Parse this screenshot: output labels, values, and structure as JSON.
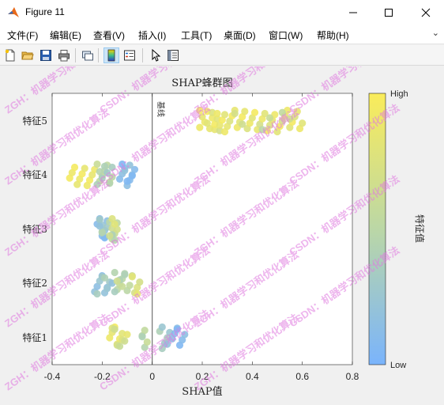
{
  "window": {
    "title": "Figure 11"
  },
  "menubar": {
    "items": [
      {
        "label": "文件(F)"
      },
      {
        "label": "编辑(E)"
      },
      {
        "label": "查看(V)"
      },
      {
        "label": "插入(I)"
      },
      {
        "label": "工具(T)"
      },
      {
        "label": "桌面(D)"
      },
      {
        "label": "窗口(W)"
      },
      {
        "label": "帮助(H)"
      }
    ],
    "more_glyph": "⌄"
  },
  "toolbar": {
    "buttons": [
      {
        "name": "new-figure-button",
        "icon": "new-file-icon"
      },
      {
        "name": "open-file-button",
        "icon": "folder-open-icon"
      },
      {
        "name": "save-button",
        "icon": "save-icon"
      },
      {
        "name": "print-button",
        "icon": "printer-icon"
      },
      {
        "name": "link-plot-button",
        "icon": "link-plot-icon"
      },
      {
        "name": "insert-colorbar-button",
        "icon": "colorbar-icon",
        "active": true
      },
      {
        "name": "insert-legend-button",
        "icon": "legend-icon"
      },
      {
        "name": "edit-plot-button",
        "icon": "pointer-icon"
      },
      {
        "name": "property-inspector-button",
        "icon": "property-inspector-icon"
      }
    ]
  },
  "colors": {
    "low": "#7ab4fc",
    "mid": "#bbd7a6",
    "high": "#faec5a",
    "watermark": "#e07ae0"
  },
  "watermark": {
    "texts": [
      "ZGH：机器学习和优化算法",
      "CSDN：机器学习和优化算法"
    ]
  },
  "chart_data": {
    "type": "scatter",
    "title": "SHAP蜂群图",
    "xlabel": "SHAP值",
    "ylabel": "",
    "xlim": [
      -0.4,
      0.8
    ],
    "xticks": [
      "-0.4",
      "-0.2",
      "0",
      "0.2",
      "0.4",
      "0.6",
      "0.8"
    ],
    "categories": [
      "特征1",
      "特征2",
      "特征3",
      "特征4",
      "特征5"
    ],
    "baseline_label": "基线",
    "baseline_x": 0,
    "colorbar": {
      "label": "特征值",
      "high": "High",
      "low": "Low"
    },
    "series": [
      {
        "feature": "特征5",
        "points": [
          [
            0.19,
            0.95
          ],
          [
            0.19,
            0.9
          ],
          [
            0.21,
            0.9
          ],
          [
            0.2,
            0.85
          ],
          [
            0.22,
            0.95
          ],
          [
            0.23,
            0.85
          ],
          [
            0.22,
            0.8
          ],
          [
            0.24,
            0.9
          ],
          [
            0.24,
            0.75
          ],
          [
            0.25,
            0.85
          ],
          [
            0.25,
            0.95
          ],
          [
            0.26,
            0.8
          ],
          [
            0.26,
            0.9
          ],
          [
            0.27,
            0.7
          ],
          [
            0.27,
            0.85
          ],
          [
            0.28,
            0.95
          ],
          [
            0.29,
            0.8
          ],
          [
            0.29,
            0.9
          ],
          [
            0.3,
            0.85
          ],
          [
            0.31,
            0.75
          ],
          [
            0.32,
            0.95
          ],
          [
            0.33,
            0.85
          ],
          [
            0.34,
            0.9
          ],
          [
            0.35,
            0.8
          ],
          [
            0.36,
            0.95
          ],
          [
            0.37,
            0.85
          ],
          [
            0.38,
            0.75
          ],
          [
            0.39,
            0.9
          ],
          [
            0.4,
            0.8
          ],
          [
            0.41,
            0.95
          ],
          [
            0.42,
            0.85
          ],
          [
            0.43,
            0.7
          ],
          [
            0.44,
            0.9
          ],
          [
            0.45,
            0.8
          ],
          [
            0.46,
            0.95
          ],
          [
            0.47,
            0.75
          ],
          [
            0.48,
            0.85
          ],
          [
            0.49,
            0.9
          ],
          [
            0.5,
            0.8
          ],
          [
            0.51,
            0.95
          ],
          [
            0.52,
            0.7
          ],
          [
            0.53,
            0.85
          ],
          [
            0.54,
            0.9
          ],
          [
            0.55,
            0.8
          ],
          [
            0.56,
            0.95
          ],
          [
            0.57,
            0.75
          ],
          [
            0.58,
            0.85
          ],
          [
            0.59,
            0.9
          ],
          [
            0.6,
            0.8
          ],
          [
            0.47,
            0.6
          ],
          [
            0.52,
            0.55
          ],
          [
            0.44,
            0.5
          ],
          [
            0.36,
            0.65
          ],
          [
            0.55,
            0.65
          ],
          [
            0.33,
            0.7
          ]
        ]
      },
      {
        "feature": "特征4",
        "points": [
          [
            -0.33,
            0.95
          ],
          [
            -0.32,
            0.9
          ],
          [
            -0.31,
            0.95
          ],
          [
            -0.3,
            0.85
          ],
          [
            -0.29,
            0.9
          ],
          [
            -0.28,
            0.95
          ],
          [
            -0.27,
            0.85
          ],
          [
            -0.26,
            0.9
          ],
          [
            -0.25,
            0.95
          ],
          [
            -0.24,
            0.85
          ],
          [
            -0.23,
            0.9
          ],
          [
            -0.22,
            0.6
          ],
          [
            -0.21,
            0.55
          ],
          [
            -0.2,
            0.65
          ],
          [
            -0.19,
            0.5
          ],
          [
            -0.18,
            0.55
          ],
          [
            -0.17,
            0.6
          ],
          [
            -0.16,
            0.5
          ],
          [
            -0.21,
            0.45
          ],
          [
            -0.19,
            0.4
          ],
          [
            -0.17,
            0.45
          ],
          [
            -0.2,
            0.35
          ],
          [
            -0.18,
            0.3
          ],
          [
            -0.16,
            0.35
          ],
          [
            -0.22,
            0.4
          ],
          [
            -0.13,
            0.1
          ],
          [
            -0.12,
            0.15
          ],
          [
            -0.11,
            0.1
          ],
          [
            -0.1,
            0.15
          ],
          [
            -0.09,
            0.1
          ],
          [
            -0.08,
            0.15
          ],
          [
            -0.07,
            0.1
          ],
          [
            -0.12,
            0.05
          ],
          [
            -0.1,
            0.05
          ],
          [
            -0.08,
            0.05
          ],
          [
            -0.11,
            0.2
          ],
          [
            -0.09,
            0.2
          ]
        ]
      },
      {
        "feature": "特征3",
        "points": [
          [
            -0.22,
            0.1
          ],
          [
            -0.21,
            0.15
          ],
          [
            -0.2,
            0.1
          ],
          [
            -0.19,
            0.2
          ],
          [
            -0.2,
            0.25
          ],
          [
            -0.21,
            0.3
          ],
          [
            -0.19,
            0.35
          ],
          [
            -0.2,
            0.4
          ],
          [
            -0.21,
            0.2
          ],
          [
            -0.18,
            0.15
          ],
          [
            -0.19,
            0.05
          ],
          [
            -0.2,
            0.45
          ],
          [
            -0.18,
            0.3
          ],
          [
            -0.17,
            0.5
          ],
          [
            -0.16,
            0.55
          ],
          [
            -0.15,
            0.6
          ],
          [
            -0.16,
            0.65
          ],
          [
            -0.14,
            0.5
          ],
          [
            -0.15,
            0.45
          ],
          [
            -0.16,
            0.4
          ],
          [
            -0.14,
            0.7
          ],
          [
            -0.15,
            0.8
          ],
          [
            -0.16,
            0.75
          ],
          [
            -0.17,
            0.65
          ]
        ]
      },
      {
        "feature": "特征2",
        "points": [
          [
            -0.23,
            0.2
          ],
          [
            -0.22,
            0.15
          ],
          [
            -0.21,
            0.25
          ],
          [
            -0.2,
            0.1
          ],
          [
            -0.19,
            0.2
          ],
          [
            -0.18,
            0.15
          ],
          [
            -0.17,
            0.3
          ],
          [
            -0.2,
            0.3
          ],
          [
            -0.22,
            0.35
          ],
          [
            -0.18,
            0.25
          ],
          [
            -0.16,
            0.2
          ],
          [
            -0.19,
            0.4
          ],
          [
            -0.15,
            0.45
          ],
          [
            -0.14,
            0.5
          ],
          [
            -0.13,
            0.55
          ],
          [
            -0.12,
            0.5
          ],
          [
            -0.11,
            0.45
          ],
          [
            -0.1,
            0.5
          ],
          [
            -0.09,
            0.55
          ],
          [
            -0.13,
            0.4
          ],
          [
            -0.11,
            0.4
          ],
          [
            -0.15,
            0.35
          ],
          [
            -0.12,
            0.6
          ],
          [
            -0.14,
            0.65
          ],
          [
            -0.08,
            0.65
          ],
          [
            -0.07,
            0.7
          ],
          [
            -0.06,
            0.75
          ],
          [
            -0.05,
            0.7
          ],
          [
            -0.08,
            0.8
          ],
          [
            -0.06,
            0.85
          ]
        ]
      },
      {
        "feature": "特征1",
        "points": [
          [
            -0.17,
            0.9
          ],
          [
            -0.16,
            0.85
          ],
          [
            -0.15,
            0.95
          ],
          [
            -0.14,
            0.85
          ],
          [
            -0.13,
            0.9
          ],
          [
            -0.12,
            0.8
          ],
          [
            -0.16,
            0.75
          ],
          [
            -0.14,
            0.7
          ],
          [
            -0.12,
            0.75
          ],
          [
            -0.1,
            0.85
          ],
          [
            -0.15,
            0.65
          ],
          [
            -0.13,
            0.6
          ],
          [
            -0.11,
            0.65
          ],
          [
            -0.04,
            0.5
          ],
          [
            -0.03,
            0.55
          ],
          [
            -0.03,
            0.45
          ],
          [
            -0.02,
            0.6
          ],
          [
            -0.04,
            0.4
          ],
          [
            0.03,
            0.4
          ],
          [
            0.04,
            0.35
          ],
          [
            0.05,
            0.3
          ],
          [
            0.06,
            0.35
          ],
          [
            0.07,
            0.25
          ],
          [
            0.04,
            0.25
          ],
          [
            0.06,
            0.2
          ],
          [
            0.08,
            0.15
          ],
          [
            0.09,
            0.1
          ],
          [
            0.1,
            0.15
          ],
          [
            0.11,
            0.05
          ],
          [
            0.12,
            0.1
          ],
          [
            0.13,
            0.15
          ],
          [
            0.1,
            0.05
          ]
        ]
      }
    ]
  }
}
